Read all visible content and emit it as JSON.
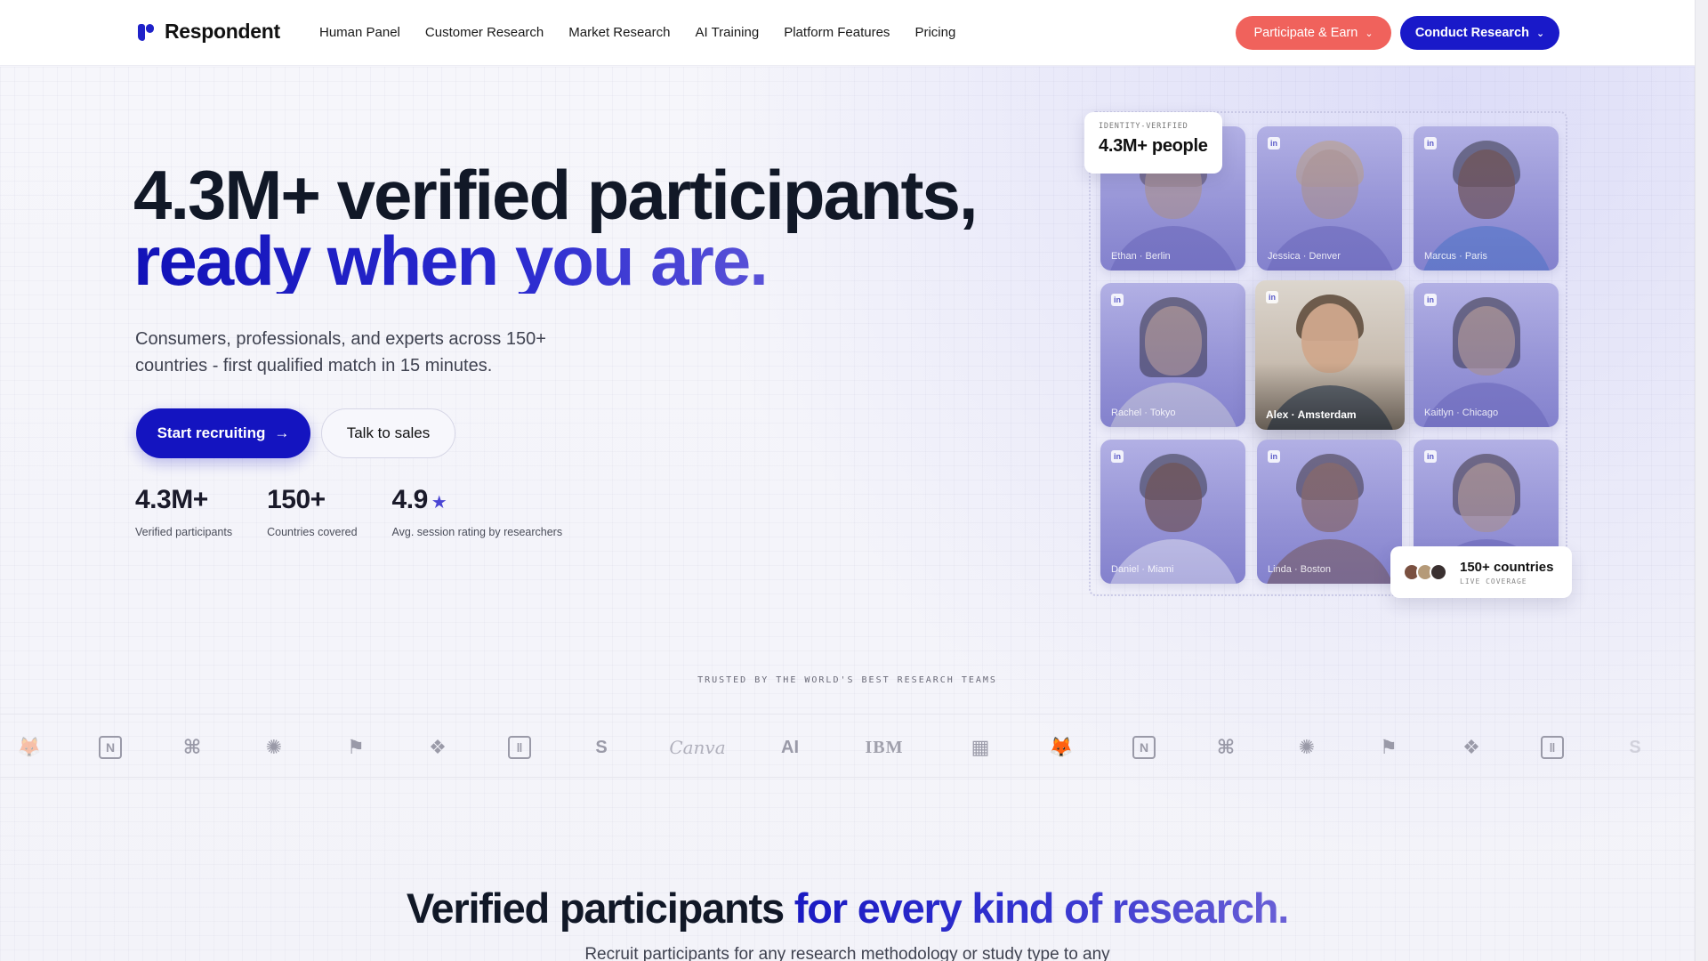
{
  "header": {
    "brand": "Respondent",
    "nav": [
      "Human Panel",
      "Customer Research",
      "Market Research",
      "AI Training",
      "Platform Features",
      "Pricing"
    ],
    "participate_label": "Participate & Earn",
    "conduct_label": "Conduct Research"
  },
  "hero": {
    "title_line1": "4.3M+ verified participants,",
    "title_line2": "ready when you are.",
    "subtitle": "Consumers, professionals, and experts across 150+ countries - first qualified match in 15 minutes.",
    "primary_cta": "Start recruiting",
    "secondary_cta": "Talk to sales",
    "stats": [
      {
        "value": "4.3M+",
        "label": "Verified participants"
      },
      {
        "value": "150+",
        "label": "Countries covered"
      },
      {
        "value": "4.9",
        "label": "Avg. session rating by researchers"
      }
    ]
  },
  "people_grid": {
    "badge_small": "IDENTITY-VERIFIED",
    "badge_big": "4.3M+ people",
    "cards": [
      {
        "caption": "Ethan · Berlin"
      },
      {
        "caption": "Jessica · Denver"
      },
      {
        "caption": "Marcus · Paris"
      },
      {
        "caption": "Rachel · Tokyo"
      },
      {
        "caption": "Alex · Amsterdam"
      },
      {
        "caption": "Kaitlyn · Chicago"
      },
      {
        "caption": "Daniel · Miami"
      },
      {
        "caption": "Linda · Boston"
      },
      {
        "caption": ""
      }
    ],
    "countries_big": "150+ countries",
    "countries_small": "LIVE COVERAGE",
    "linkedin_glyph": "in"
  },
  "trusted": {
    "label": "TRUSTED BY THE WORLD'S BEST RESEARCH TEAMS",
    "logos": [
      "gitlab-icon",
      "notion-icon",
      "figma-icon",
      "anthropic-claude-icon",
      "miro-icon",
      "dropbox-icon",
      "intercom-icon",
      "stripe-icon",
      "Canva",
      "AI",
      "IBM",
      "microsoft-icon",
      "gitlab-icon",
      "notion-icon",
      "figma-icon",
      "anthropic-claude-icon",
      "miro-icon",
      "dropbox-icon",
      "intercom-icon",
      "stripe-icon"
    ]
  },
  "section": {
    "title_plain": "Verified participants",
    "title_accent": "for every kind of research.",
    "subtitle": "Recruit participants for any research methodology or study type to any"
  },
  "colors": {
    "brand_blue": "#1919c9",
    "coral": "#f0625c",
    "accent_purple": "#6d63d6"
  }
}
